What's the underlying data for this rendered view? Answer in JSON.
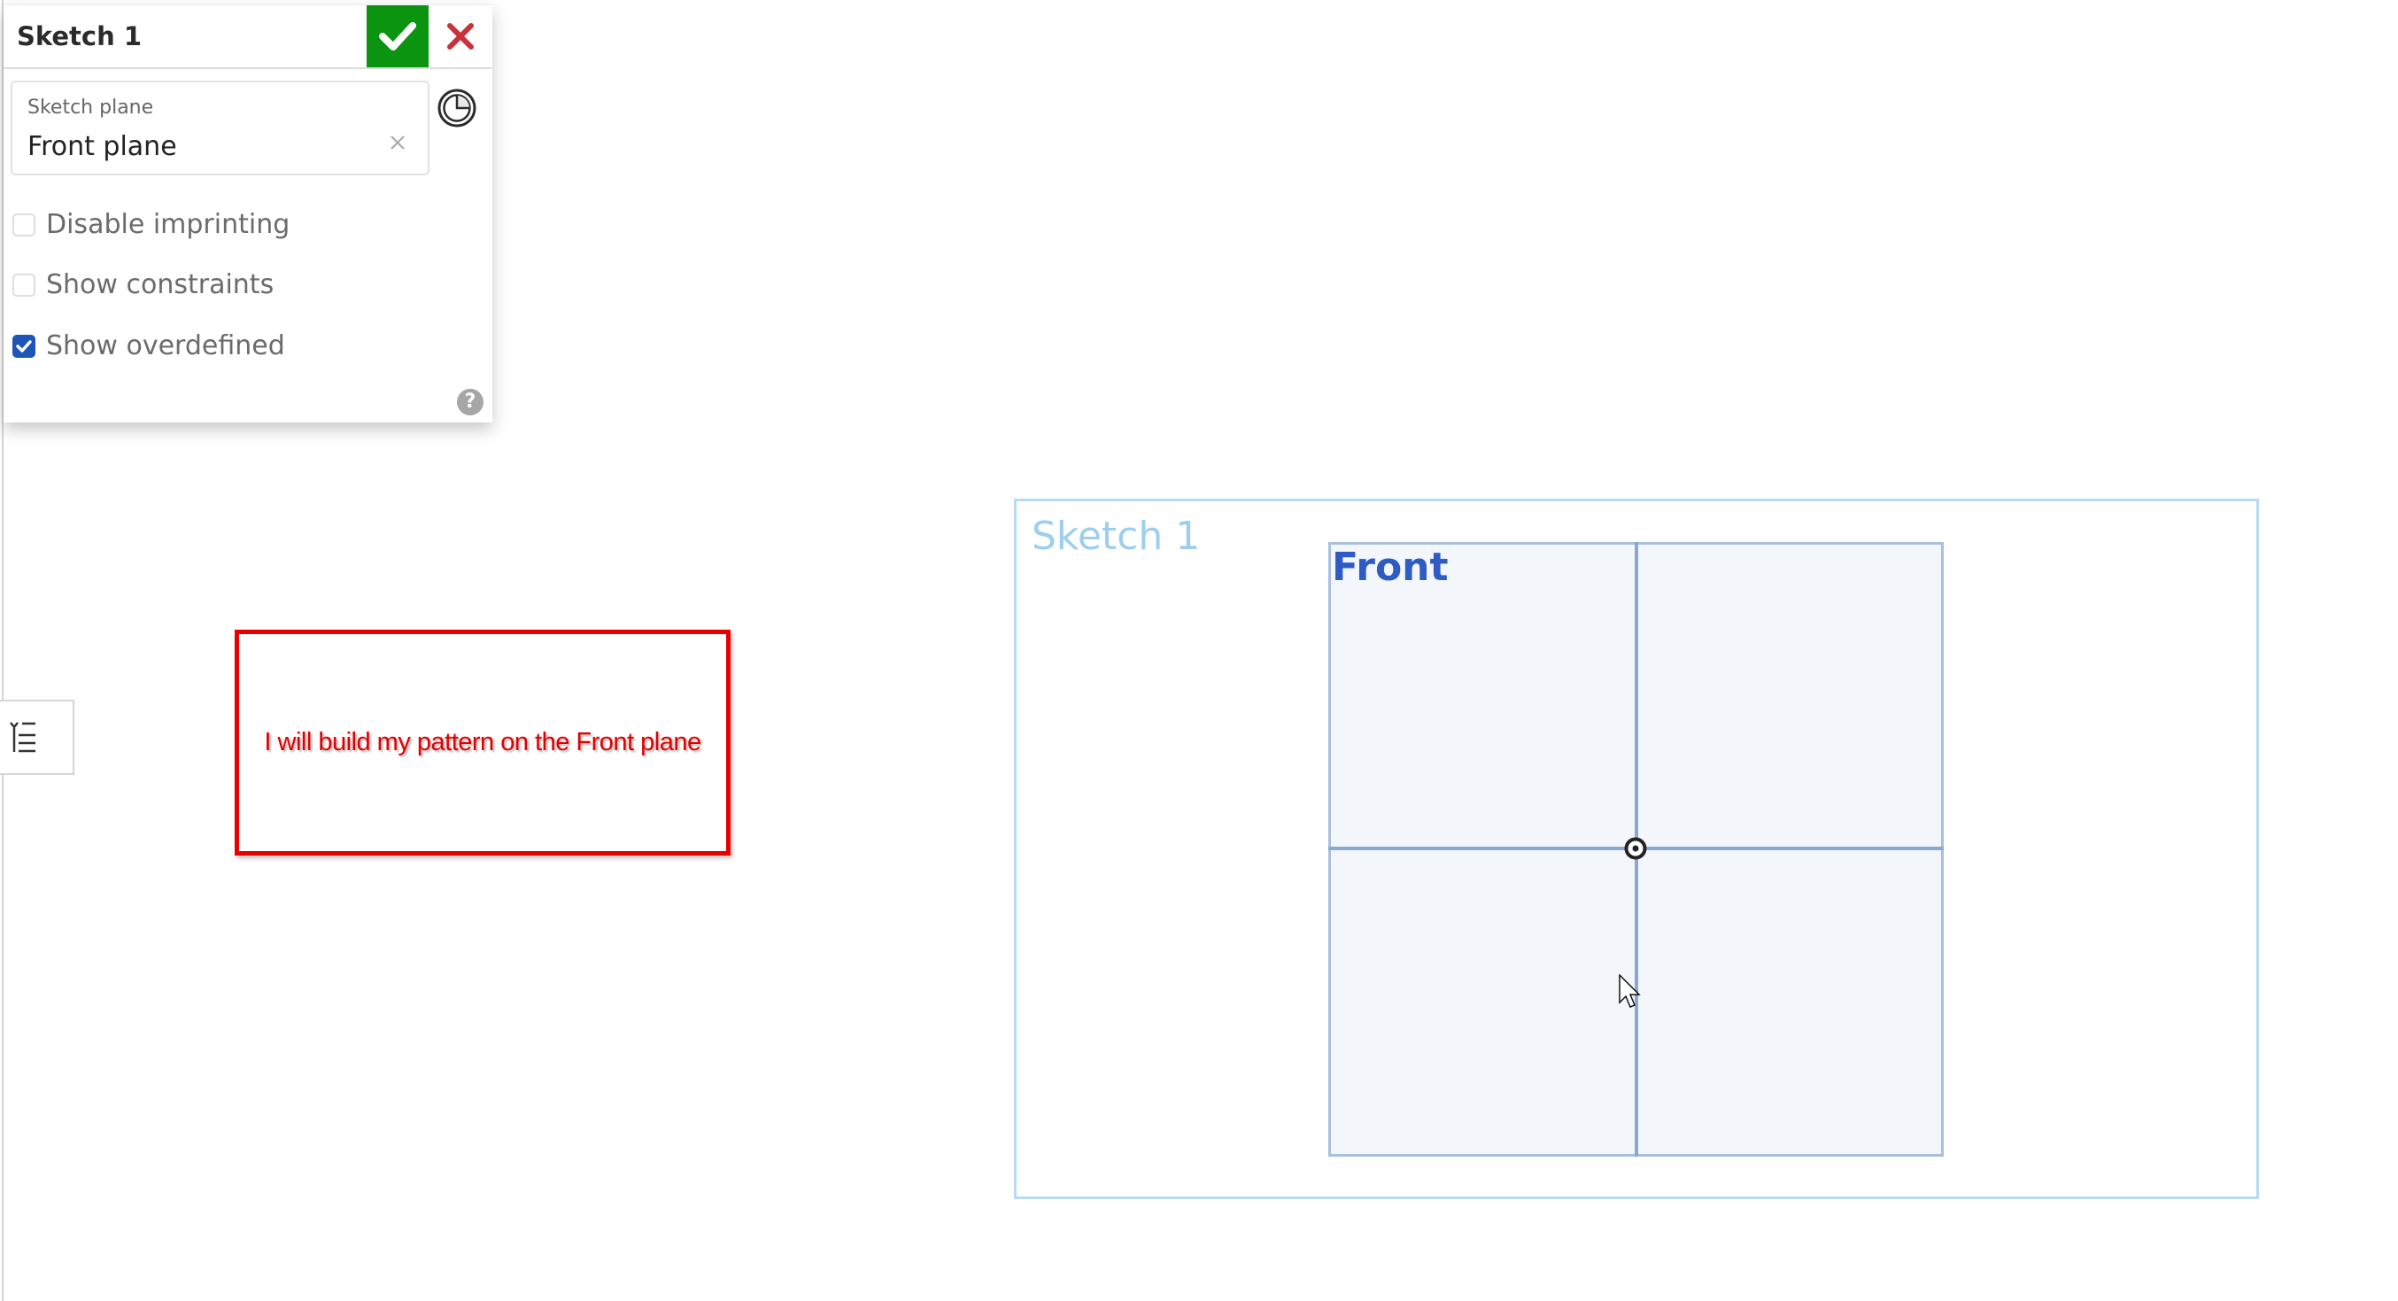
{
  "dialog": {
    "title": "Sketch 1",
    "ok_icon": "checkmark-icon",
    "cancel_icon": "close-icon",
    "sketch_plane": {
      "label": "Sketch plane",
      "value": "Front plane",
      "clear_icon": "clear-icon"
    },
    "history_icon": "clock-icon",
    "options": [
      {
        "label": "Disable imprinting",
        "checked": false
      },
      {
        "label": "Show constraints",
        "checked": false
      },
      {
        "label": "Show overdefined",
        "checked": true
      }
    ],
    "help_label": "?"
  },
  "side_tab": {
    "icon": "checklist-icon"
  },
  "annotation": {
    "text": "I will build my pattern on the Front plane",
    "color": "#e00000"
  },
  "viewport": {
    "sketch_label": "Sketch 1",
    "plane_label": "Front",
    "origin_icon": "origin-icon",
    "cursor_icon": "arrow-cursor-icon"
  },
  "colors": {
    "accept": "#0b9410",
    "cancel": "#c8323c",
    "checkbox_on": "#1c57b8",
    "plane_label": "#2f5bc4",
    "sketch_label": "#9ccfee"
  }
}
